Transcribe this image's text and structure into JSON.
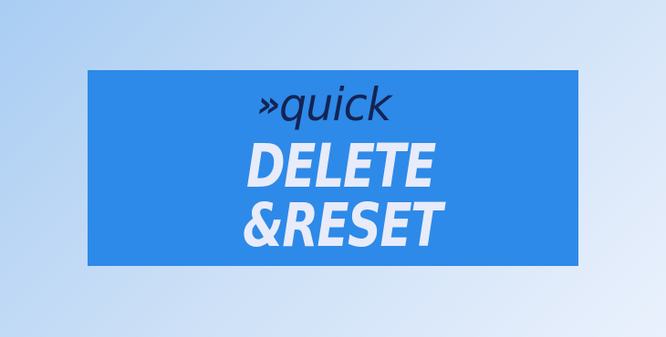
{
  "banner": {
    "arrows": "»",
    "word_quick": "quick",
    "line_delete": "DELETE",
    "line_reset": "&RESET",
    "colors": {
      "background": "#2d8ae8",
      "quick_text": "#152354",
      "main_text": "#e8ebf9"
    }
  }
}
